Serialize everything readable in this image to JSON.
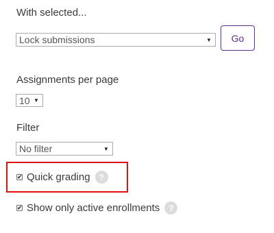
{
  "bulk_action": {
    "heading": "With selected...",
    "selected": "Lock submissions",
    "go_label": "Go"
  },
  "per_page": {
    "heading": "Assignments per page",
    "selected": "10"
  },
  "filter": {
    "heading": "Filter",
    "selected": "No filter"
  },
  "options": {
    "quick_grading": {
      "label": "Quick grading",
      "checked": true,
      "help_icon": "question-icon"
    },
    "show_active": {
      "label": "Show only active enrollments",
      "checked": true,
      "help_icon": "question-icon"
    }
  },
  "colors": {
    "accent": "#5b2d8a",
    "highlight": "#e01010",
    "help_icon_bg": "#dcdcdc"
  }
}
